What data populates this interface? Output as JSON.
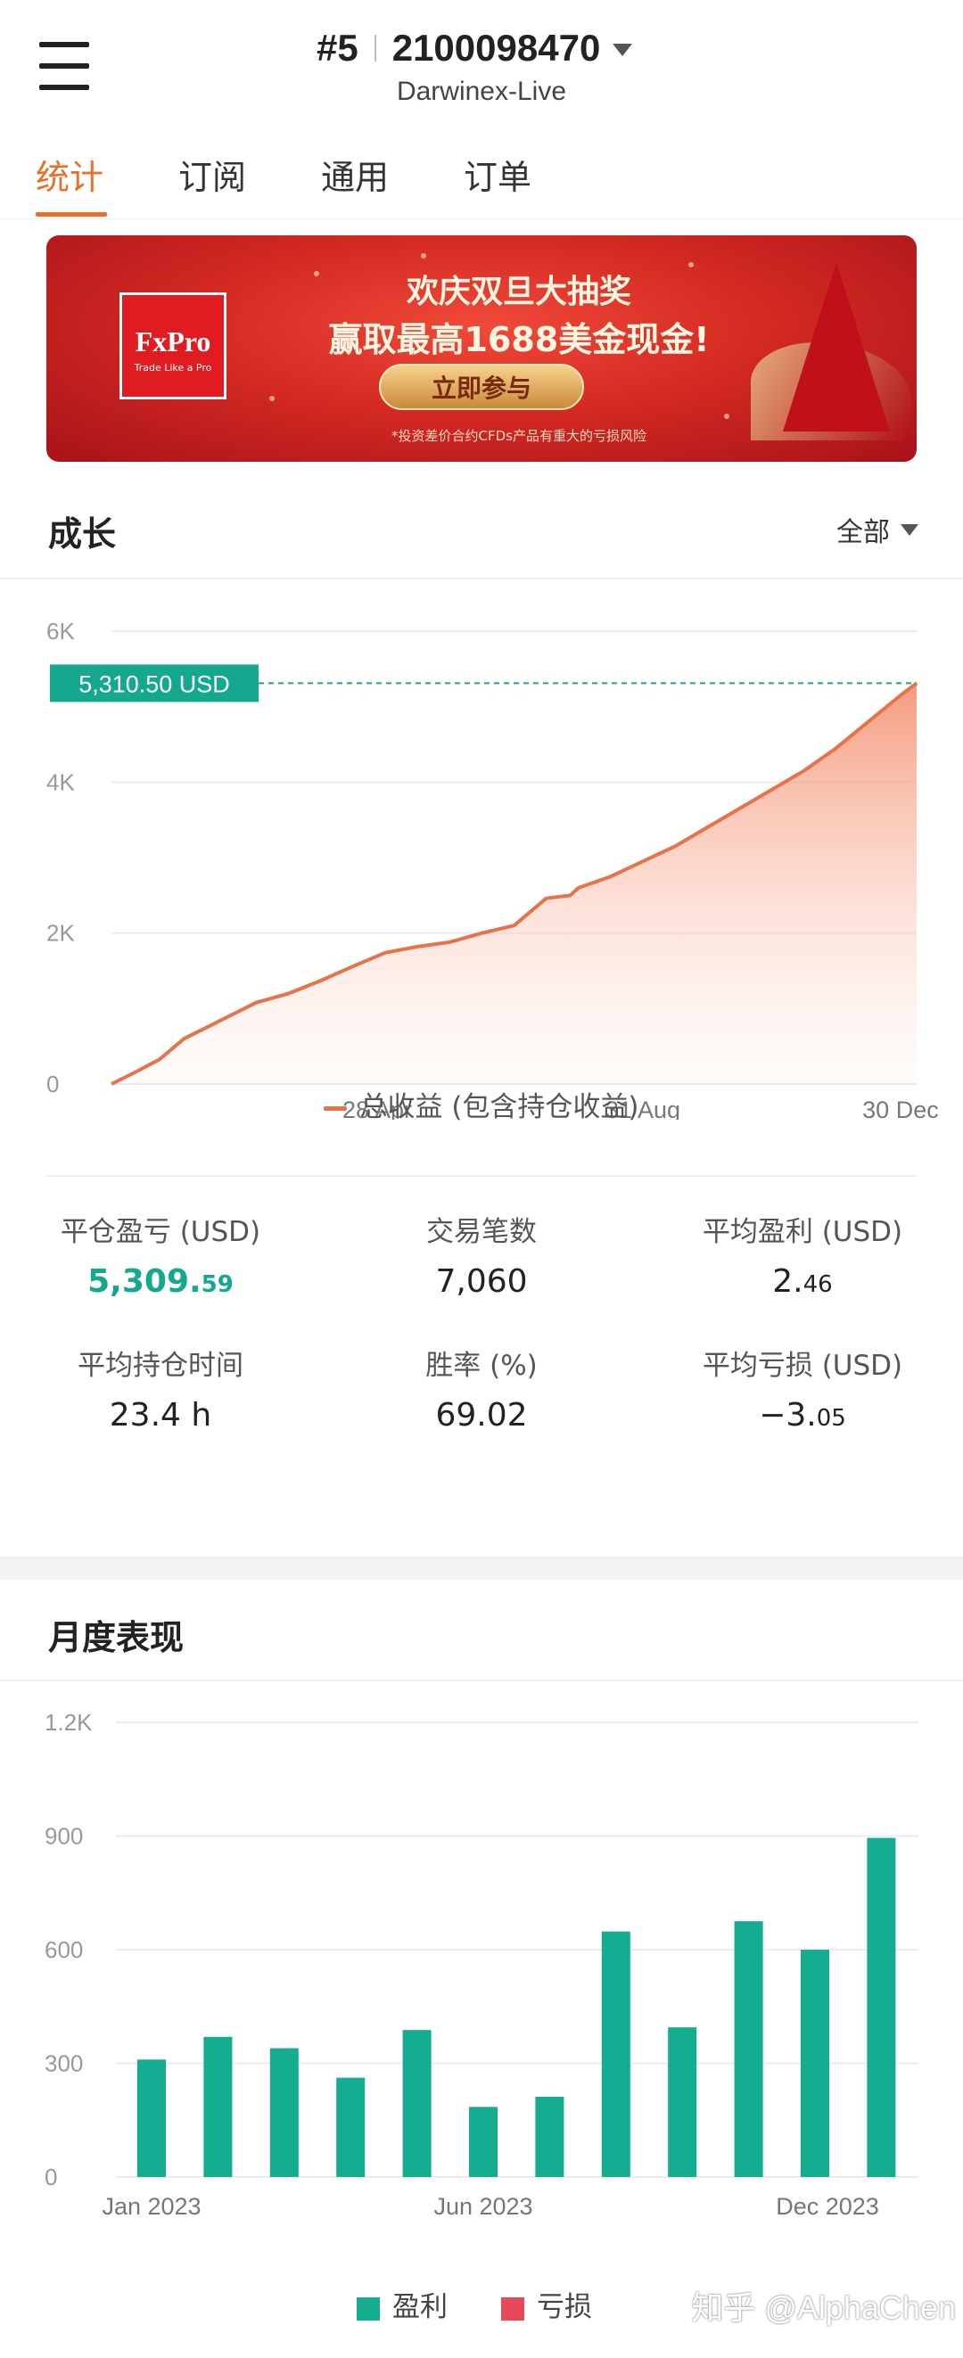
{
  "header": {
    "rank": "#5",
    "account_id": "2100098470",
    "server": "Darwinex-Live"
  },
  "tabs": [
    {
      "label": "统计",
      "active": true
    },
    {
      "label": "订阅",
      "active": false
    },
    {
      "label": "通用",
      "active": false
    },
    {
      "label": "订单",
      "active": false
    }
  ],
  "banner": {
    "brand": "FxPro",
    "brand_tagline": "Trade Like a Pro",
    "line1": "欢庆双旦大抽奖",
    "line2": "赢取最高1688美金现金!",
    "cta": "立即参与",
    "disclaimer": "*投资差价合约CFDs产品有重大的亏损风险"
  },
  "growth": {
    "title": "成长",
    "range_label": "全部",
    "current_value_label": "5,310.50 USD",
    "legend": "总收益 (包含持仓收益)",
    "accent_color": "#e8724a"
  },
  "stats": {
    "closed_pnl_label": "平仓盈亏 (USD)",
    "closed_pnl_main": "5,309.",
    "closed_pnl_frac": "59",
    "trades_label": "交易笔数",
    "trades_value": "7,060",
    "avg_profit_label": "平均盈利 (USD)",
    "avg_profit_main": "2.",
    "avg_profit_frac": "46",
    "avg_hold_label": "平均持仓时间",
    "avg_hold_value": "23.4 h",
    "winrate_label": "胜率 (%)",
    "winrate_value": "69.02",
    "avg_loss_label": "平均亏损 (USD)",
    "avg_loss_main": "−3.",
    "avg_loss_frac": "05"
  },
  "monthly": {
    "title": "月度表现",
    "legend_profit": "盈利",
    "legend_loss": "亏损",
    "profit_color": "#14ad8f",
    "loss_color": "#e8485a"
  },
  "watermark": "知乎 @AlphaChen",
  "chart_data": [
    {
      "type": "area",
      "title": "",
      "series": [
        {
          "name": "总收益 (包含持仓收益)",
          "color": "#e8724a"
        }
      ],
      "x": [
        0,
        0.03,
        0.06,
        0.09,
        0.12,
        0.15,
        0.18,
        0.22,
        0.26,
        0.3,
        0.34,
        0.38,
        0.42,
        0.46,
        0.5,
        0.54,
        0.57,
        0.58,
        0.62,
        0.66,
        0.7,
        0.74,
        0.78,
        0.82,
        0.86,
        0.9,
        0.94,
        0.98,
        1.0
      ],
      "y": [
        0,
        160,
        330,
        600,
        760,
        920,
        1080,
        1200,
        1370,
        1560,
        1740,
        1820,
        1880,
        2000,
        2100,
        2460,
        2500,
        2600,
        2750,
        2950,
        3150,
        3400,
        3650,
        3900,
        4150,
        4450,
        4800,
        5150,
        5310
      ],
      "xtick_labels": [
        "28 Apr",
        "31 Aug",
        "30 Dec"
      ],
      "xtick_positions": [
        0.33,
        0.66,
        0.98
      ],
      "yticks": [
        "0",
        "2K",
        "4K",
        "6K"
      ],
      "ylim": [
        0,
        6000
      ],
      "current_value": 5310.5
    },
    {
      "type": "bar",
      "title": "",
      "categories": [
        "Jan 2023",
        "Feb",
        "Mar",
        "Apr",
        "May",
        "Jun 2023",
        "Jul",
        "Aug",
        "Sep",
        "Oct",
        "Nov",
        "Dec 2023"
      ],
      "xtick_labels": [
        "Jan 2023",
        "Jun 2023",
        "Dec 2023"
      ],
      "series": [
        {
          "name": "盈利",
          "values": [
            310,
            370,
            340,
            262,
            388,
            185,
            212,
            648,
            395,
            675,
            600,
            895
          ]
        },
        {
          "name": "亏损",
          "values": [
            0,
            0,
            0,
            0,
            0,
            0,
            0,
            0,
            0,
            0,
            0,
            0
          ]
        }
      ],
      "yticks": [
        "0",
        "300",
        "600",
        "900",
        "1.2K"
      ],
      "ylim": [
        0,
        1200
      ]
    }
  ]
}
